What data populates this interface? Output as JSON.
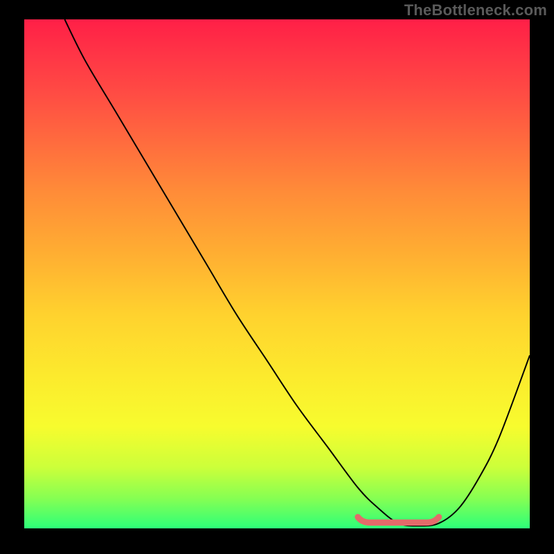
{
  "watermark": "TheBottleneck.com",
  "chart_data": {
    "type": "line",
    "title": "",
    "xlabel": "",
    "ylabel": "",
    "xlim": [
      0,
      100
    ],
    "ylim": [
      0,
      100
    ],
    "series": [
      {
        "name": "bottleneck-curve",
        "x": [
          8,
          12,
          18,
          24,
          30,
          36,
          42,
          48,
          54,
          60,
          66,
          70,
          74,
          78,
          82,
          86,
          90,
          94,
          100
        ],
        "values": [
          100,
          92,
          82,
          72,
          62,
          52,
          42,
          33,
          24,
          16,
          8,
          4,
          1,
          0.5,
          1,
          4,
          10,
          18,
          34
        ]
      }
    ],
    "trough_highlight": {
      "x_start": 66,
      "x_end": 82,
      "value": 1
    },
    "background_gradient": {
      "top": "#ff1f47",
      "mid": "#ffd22e",
      "bottom": "#2dff79"
    }
  }
}
